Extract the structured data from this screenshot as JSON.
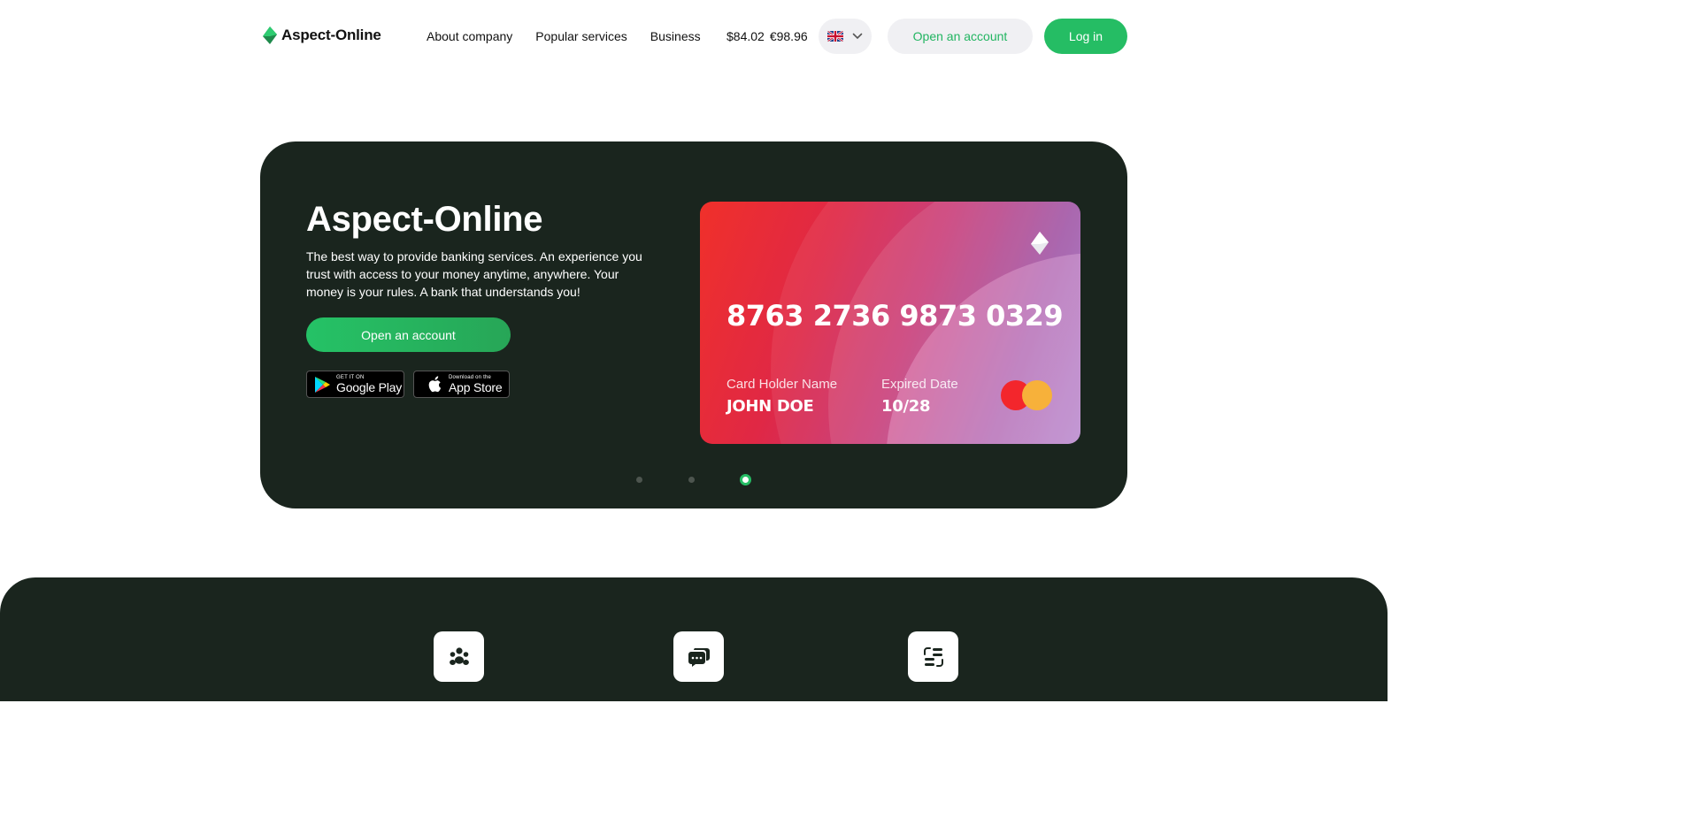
{
  "header": {
    "logo_text": "Aspect-Online",
    "nav": [
      {
        "label": "About company"
      },
      {
        "label": "Popular services"
      },
      {
        "label": "Business"
      }
    ],
    "rates": {
      "usd": "$84.02",
      "eur": "€98.96"
    },
    "language": {
      "icon": "uk-flag-icon",
      "dropdown_icon": "chevron-down-icon"
    },
    "open_account_label": "Open an account",
    "login_label": "Log in"
  },
  "hero": {
    "title": "Aspect-Online",
    "description": "The best way to provide banking services. An experience you trust with access to your money anytime, anywhere. Your money is your rules. A bank that understands you!",
    "cta_label": "Open an account",
    "google_play": {
      "small": "GET IT ON",
      "big": "Google Play"
    },
    "app_store": {
      "small": "Download on the",
      "big": "App Store"
    },
    "card": {
      "number": "8763 2736 9873 0329",
      "holder_label": "Card Holder Name",
      "holder_value": "JOHN DOE",
      "expiry_label": "Expired Date",
      "expiry_value": "10/28",
      "brand_icon": "mastercard-icon"
    },
    "carousel": {
      "count": 3,
      "active_index": 2
    }
  },
  "features": {
    "icons": [
      "people-icon",
      "chat-icon",
      "transfer-icon"
    ]
  },
  "colors": {
    "accent": "#25bd64",
    "dark_bg": "#1a251e",
    "pill_bg": "#f0f0f3"
  }
}
